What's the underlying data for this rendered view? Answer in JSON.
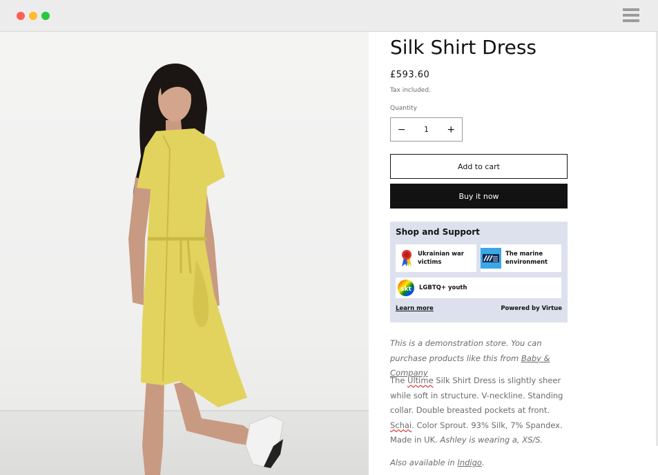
{
  "window": {
    "controls": [
      "close",
      "minimize",
      "maximize"
    ],
    "menu_icon": "hamburger-menu-icon"
  },
  "product": {
    "title": "Silk Shirt Dress",
    "price": "£593.60",
    "tax_note": "Tax included.",
    "image_alt": "Model wearing yellow silk shirt dress"
  },
  "quantity": {
    "label": "Quantity",
    "value": "1",
    "decrease_label": "−",
    "increase_label": "+"
  },
  "buttons": {
    "add_to_cart": "Add to cart",
    "buy_now": "Buy it now"
  },
  "support_widget": {
    "title": "Shop and Support",
    "causes": [
      {
        "label": "Ukrainian war victims",
        "icon": "ribbon-icon"
      },
      {
        "label": "The marine environment",
        "icon": "marine-logo-icon"
      },
      {
        "label": "LGBTQ+ youth",
        "icon": "skt-rainbow-logo-icon"
      }
    ],
    "learn_more": "Learn more",
    "powered_by": "Powered by Virtue"
  },
  "description": {
    "intro_prefix": "This is a demonstration store. You can purchase products like this from ",
    "intro_link": "Baby & Company",
    "p1_a": "The ",
    "p1_brand": "Ultime",
    "p1_b": " Silk Shirt Dress is slightly sheer while soft in structure. V-neckline. Standing collar. Double breasted pockets at front. ",
    "p1_word": "Schai",
    "p1_c": ". Color Sprout. 93% Silk, 7% Spandex. Made in UK. ",
    "p1_italic": "Ashley is wearing a, XS/S.",
    "also_prefix": "Also available in ",
    "also_link": "Indigo",
    "also_suffix": "."
  },
  "colors": {
    "accent": "#121212",
    "widget_bg": "#dde1ee",
    "dress": "#e2d35e"
  }
}
